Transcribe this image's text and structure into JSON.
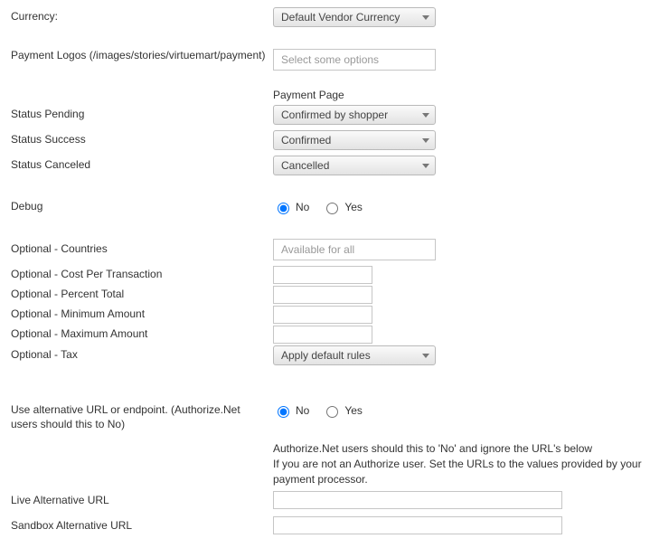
{
  "currency": {
    "label": "Currency:",
    "value": "Default Vendor Currency"
  },
  "logos": {
    "label": "Payment Logos (/images/stories/virtuemart/payment)",
    "placeholder": "Select some options"
  },
  "paymentPage": {
    "heading": "Payment Page",
    "pending": {
      "label": "Status Pending",
      "value": "Confirmed by shopper"
    },
    "success": {
      "label": "Status Success",
      "value": "Confirmed"
    },
    "canceled": {
      "label": "Status Canceled",
      "value": "Cancelled"
    }
  },
  "debug": {
    "label": "Debug",
    "no": "No",
    "yes": "Yes"
  },
  "optional": {
    "countries": {
      "label": "Optional - Countries",
      "placeholder": "Available for all"
    },
    "costPerTx": {
      "label": "Optional - Cost Per Transaction",
      "value": ""
    },
    "percentTotal": {
      "label": "Optional - Percent Total",
      "value": ""
    },
    "minAmount": {
      "label": "Optional - Minimum Amount",
      "value": ""
    },
    "maxAmount": {
      "label": "Optional - Maximum Amount",
      "value": ""
    },
    "tax": {
      "label": "Optional - Tax",
      "value": "Apply default rules"
    }
  },
  "altUrl": {
    "label": "Use alternative URL or endpoint. (Authorize.Net users should this to No)",
    "no": "No",
    "yes": "Yes",
    "help1": "Authorize.Net users should this to 'No' and ignore the URL's below",
    "help2": "If you are not an Authorize user. Set the URLs to the values provided by your payment processor."
  },
  "liveUrl": {
    "label": "Live Alternative URL",
    "value": ""
  },
  "sandboxUrl": {
    "label": "Sandbox Alternative URL",
    "value": ""
  }
}
